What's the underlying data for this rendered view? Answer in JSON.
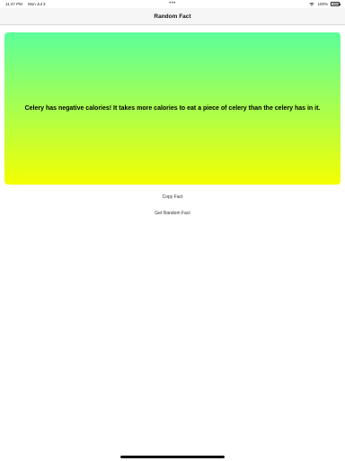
{
  "status_bar": {
    "time": "11:47 PM",
    "date": "Mon Jul 3",
    "multitask": "•••",
    "battery": "100%"
  },
  "nav": {
    "title": "Random Fact"
  },
  "fact": {
    "text": "Celery has negative calories! It takes more calories to eat a piece of celery than the celery has in it."
  },
  "buttons": {
    "copy_label": "Copy Fact",
    "random_label": "Get Random Fact"
  },
  "colors": {
    "gradient_top": "#5cff9b",
    "gradient_bottom": "#f5ff00",
    "background": "#ffffff"
  },
  "icons": {
    "wifi": "wifi-icon",
    "battery": "battery-icon"
  }
}
